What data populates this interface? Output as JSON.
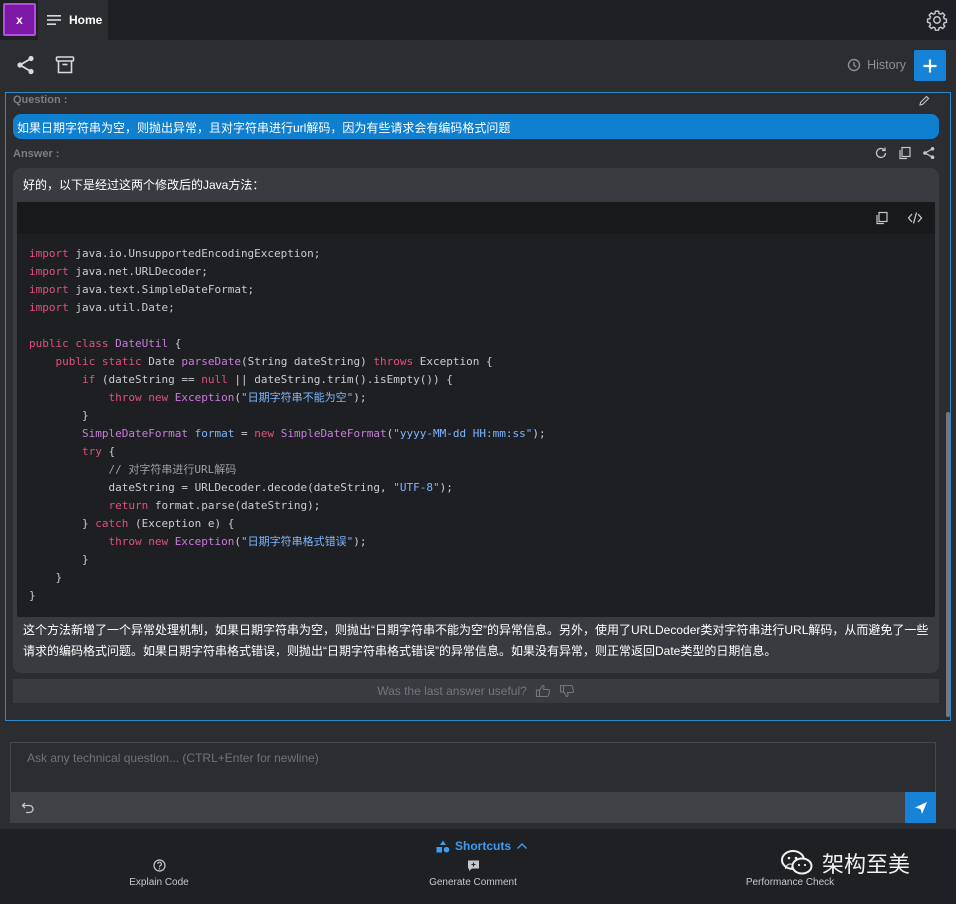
{
  "app": {
    "logo_letter": "x",
    "accent": "#1683d8",
    "brand": "#7d18a6"
  },
  "tabs": [
    {
      "label": "Home",
      "icon": "menu-icon"
    }
  ],
  "toolbar": {
    "history_label": "History",
    "new_chat_icon": "plus-icon"
  },
  "chat": {
    "question_label": "Question :",
    "question_text": "如果日期字符串为空，则抛出异常，且对字符串进行url解码，因为有些请求会有编码格式问题",
    "answer_label": "Answer :",
    "answer_intro": "好的，以下是经过这两个修改后的Java方法：",
    "code_lines": [
      "import java.io.UnsupportedEncodingException;",
      "import java.net.URLDecoder;",
      "import java.text.SimpleDateFormat;",
      "import java.util.Date;",
      "",
      "public class DateUtil {",
      "    public static Date parseDate(String dateString) throws Exception {",
      "        if (dateString == null || dateString.trim().isEmpty()) {",
      "            throw new Exception(\"日期字符串不能为空\");",
      "        }",
      "        SimpleDateFormat format = new SimpleDateFormat(\"yyyy-MM-dd HH:mm:ss\");",
      "        try {",
      "            // 对字符串进行URL解码",
      "            dateString = URLDecoder.decode(dateString, \"UTF-8\");",
      "            return format.parse(dateString);",
      "        } catch (Exception e) {",
      "            throw new Exception(\"日期字符串格式错误\");",
      "        }",
      "    }",
      "}"
    ],
    "answer_desc": "这个方法新增了一个异常处理机制，如果日期字符串为空，则抛出“日期字符串不能为空”的异常信息。另外，使用了URLDecoder类对字符串进行URL解码，从而避免了一些请求的编码格式问题。如果日期字符串格式错误，则抛出“日期字符串格式错误”的异常信息。如果没有异常，则正常返回Date类型的日期信息。",
    "feedback_prompt": "Was the last answer useful?"
  },
  "input": {
    "placeholder": "Ask any technical question... (CTRL+Enter for newline)"
  },
  "shortcuts": {
    "title": "Shortcuts",
    "items": [
      {
        "label": "Explain Code",
        "icon": "question-circle-icon"
      },
      {
        "label": "Generate Comment",
        "icon": "comment-icon"
      },
      {
        "label": "Performance Check",
        "icon": "gauge-icon"
      }
    ]
  },
  "watermark": "架构至美"
}
